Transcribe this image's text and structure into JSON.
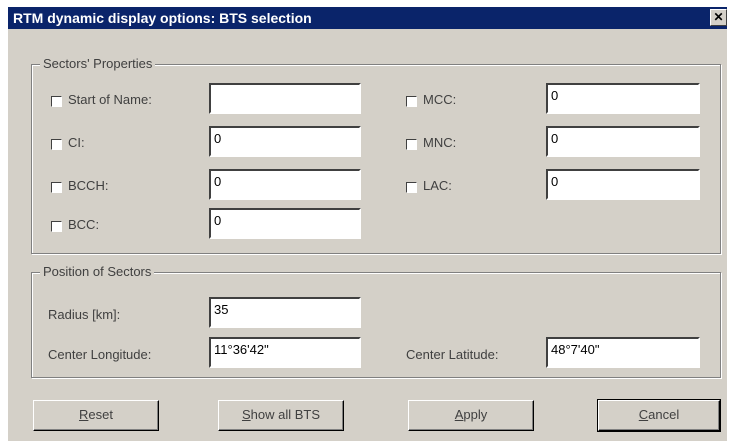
{
  "window": {
    "title": "RTM dynamic display options: BTS selection",
    "close_glyph": "✕"
  },
  "sectors": {
    "legend": "Sectors' Properties",
    "fields": {
      "start_of_name": {
        "label": "Start of Name:",
        "value": "",
        "checked": false
      },
      "ci": {
        "label": "CI:",
        "value": "0",
        "checked": false
      },
      "bcch": {
        "label": "BCCH:",
        "value": "0",
        "checked": false
      },
      "bcc": {
        "label": "BCC:",
        "value": "0",
        "checked": false
      },
      "mcc": {
        "label": "MCC:",
        "value": "0",
        "checked": false
      },
      "mnc": {
        "label": "MNC:",
        "value": "0",
        "checked": false
      },
      "lac": {
        "label": "LAC:",
        "value": "0",
        "checked": false
      }
    }
  },
  "position": {
    "legend": "Position of Sectors",
    "radius": {
      "label": "Radius [km]:",
      "value": "35"
    },
    "center_lon": {
      "label": "Center Longitude:",
      "value": "11°36'42\""
    },
    "center_lat": {
      "label": "Center Latitude:",
      "value": "48°7'40\""
    }
  },
  "buttons": {
    "reset": {
      "accel": "R",
      "rest": "eset"
    },
    "show_all": {
      "accel": "S",
      "rest": "how all BTS"
    },
    "apply": {
      "accel": "A",
      "rest": "pply"
    },
    "cancel": {
      "accel": "C",
      "rest": "ancel"
    }
  }
}
